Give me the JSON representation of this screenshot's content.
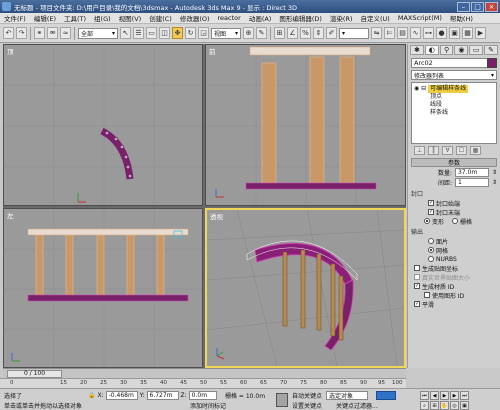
{
  "titlebar": {
    "title": "无标题 - 项目文件夹: D:\\用户目录\\我的文档\\3dsmax - Autodesk 3ds Max 9 - 显示 : Direct 3D"
  },
  "menubar": {
    "items": [
      "文件(F)",
      "编辑(E)",
      "工具(T)",
      "组(G)",
      "视图(V)",
      "创建(C)",
      "修改器(O)",
      "reactor",
      "动画(A)",
      "图形编辑器(D)",
      "渲染(R)",
      "自定义(U)",
      "MAXScript(M)",
      "帮助(H)"
    ]
  },
  "toolbar": {
    "selection_filter": "全部",
    "view_dropdown": "视图"
  },
  "viewports": {
    "top_left": {
      "label": "顶"
    },
    "top_right": {
      "label": "前"
    },
    "bottom_left": {
      "label": "左"
    },
    "bottom_right": {
      "label": "透视"
    }
  },
  "command_panel": {
    "object_name": "Arc02",
    "modifier_list": "修改器列表",
    "stack": {
      "items": [
        "可编辑样条线",
        "顶点",
        "线段",
        "样条线"
      ]
    },
    "rollout_params": "参数",
    "count_label": "数量:",
    "count_value": "37.0m",
    "spacing_label": "间距:",
    "spacing_value": "1",
    "cap_group": "封口",
    "cap_start": "封口始端",
    "cap_end": "封口末端",
    "morph": "变形",
    "grid": "栅格",
    "output_group": "输出",
    "output_patch": "面片",
    "output_mesh": "网格",
    "output_nurbs": "NURBS",
    "gen_mapping": "生成贴图坐标",
    "real_world": "真实世界贴图大小",
    "gen_matid": "生成材质 ID",
    "use_shape": "使用图形 ID",
    "smooth": "平滑"
  },
  "timeline": {
    "frame": "0 / 100"
  },
  "ruler": {
    "ticks": [
      "0",
      "15",
      "20",
      "25",
      "30",
      "35",
      "40",
      "45",
      "50",
      "55",
      "60",
      "65",
      "70",
      "75",
      "80",
      "85",
      "90",
      "95",
      "100"
    ]
  },
  "statusbar": {
    "status": "选择了",
    "x_label": "X:",
    "x_value": "-0.468m",
    "y_label": "Y:",
    "y_value": "6.727m",
    "z_label": "Z:",
    "z_value": "0.0m",
    "grid_label": "栅格 = 10.0m",
    "row2_left": "单击或单击并拖动以选择对象",
    "row2_addtime": "添加时间标记",
    "autokey": "自动关键点",
    "selected_obj": "选定对象",
    "setkey": "设置关键点",
    "keyfilter": "关键点过滤器..."
  },
  "colors": {
    "arch_magenta": "#7a1f6a",
    "pillar": "#b88a50",
    "wire_peach": "#e0b080",
    "viewport_bg": "#9a9a9a",
    "active_border": "#f0d75a"
  }
}
